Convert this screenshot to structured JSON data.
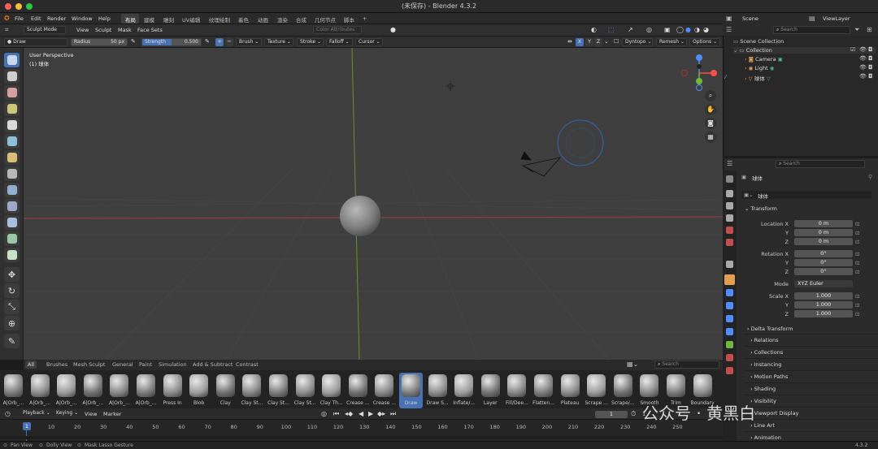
{
  "window": {
    "title": "(未保存) - Blender 4.3.2"
  },
  "menu": {
    "file": "File",
    "edit": "Edit",
    "render": "Render",
    "window": "Window",
    "help": "Help"
  },
  "workspaces": [
    "布局",
    "建模",
    "雕刻",
    "UV编辑",
    "纹理绘制",
    "着色",
    "动画",
    "渲染",
    "合成",
    "几何节点",
    "脚本",
    "+"
  ],
  "scene": {
    "name": "Scene",
    "view_layer": "ViewLayer"
  },
  "header": {
    "mode": "Sculpt Mode",
    "view": "View",
    "sculpt": "Sculpt",
    "mask": "Mask",
    "face_sets": "Face Sets",
    "color_attributes": "Color Attributes"
  },
  "tool": {
    "brush": "Draw",
    "radius_label": "Radius",
    "radius_value": "50 px",
    "strength_label": "Strength",
    "strength_value": "0.500",
    "strength_fraction": 0.5,
    "brush_menu": "Brush",
    "texture": "Texture",
    "stroke": "Stroke",
    "falloff": "Falloff",
    "cursor": "Cursor",
    "x": "X",
    "y": "Y",
    "z": "Z",
    "dyntopo": "Dyntopo",
    "remesh": "Remesh",
    "options": "Options"
  },
  "viewport": {
    "perspective": "User Perspective",
    "object": "(1) 球体"
  },
  "brush_tabs": [
    "All",
    "Brushes",
    "Mesh Sculpt",
    "General",
    "Paint",
    "Simulation",
    "Add & Subtract",
    "Contrast"
  ],
  "brush_search": "Search",
  "brushes": [
    "A|Orb_...",
    "A|Orb_...",
    "A|Orb_...",
    "A|Orb_...",
    "A|Orb_...",
    "A|Orb_...",
    "Press In",
    "Blob",
    "Clay",
    "Clay St...",
    "Clay St...",
    "Clay St...",
    "Clay Th...",
    "Crease ...",
    "Crease ...",
    "Draw",
    "Draw S...",
    "Inflate/...",
    "Layer",
    "Fill/Dee...",
    "Flatten...",
    "Plateau",
    "Scrape ...",
    "Scrape/...",
    "Smooth",
    "Trim",
    "Boundary"
  ],
  "timeline": {
    "playback": "Playback",
    "keying": "Keying",
    "view": "View",
    "marker": "Marker",
    "current_frame": "1",
    "frame_input": "1",
    "start": "1",
    "ticks": [
      "10",
      "20",
      "30",
      "40",
      "50",
      "60",
      "70",
      "80",
      "90",
      "100",
      "110",
      "120",
      "130",
      "140",
      "150",
      "160",
      "170",
      "180",
      "190",
      "200",
      "210",
      "220",
      "230",
      "240",
      "250"
    ]
  },
  "status": {
    "pan": "Pan View",
    "dolly": "Dolly View",
    "lasso": "Mask Lasso Gesture",
    "version": "4.3.2"
  },
  "outliner": {
    "search": "Search",
    "scene_collection": "Scene Collection",
    "collection": "Collection",
    "items": [
      "Camera",
      "Light",
      "球体"
    ]
  },
  "properties": {
    "search": "Search",
    "object_name": "球体",
    "data_name": "球体",
    "transform": "Transform",
    "location_label": "Location X",
    "y": "Y",
    "z": "Z",
    "location": [
      "0 m",
      "0 m",
      "0 m"
    ],
    "rotation_label": "Rotation X",
    "rotation": [
      "0°",
      "0°",
      "0°"
    ],
    "mode_label": "Mode",
    "mode": "XYZ Euler",
    "scale_label": "Scale X",
    "scale": [
      "1.000",
      "1.000",
      "1.000"
    ],
    "sections": [
      "Delta Transform",
      "Relations",
      "Collections",
      "Instancing",
      "Motion Paths",
      "Shading",
      "Visibility",
      "Viewport Display",
      "Line Art",
      "Animation"
    ]
  },
  "watermark": "公众号 · 黄黑白",
  "colors": {
    "accent": "#4772b3",
    "axis_red": "#ff4b4b",
    "axis_green": "#6fb93b",
    "axis_blue": "#4e8fff"
  }
}
